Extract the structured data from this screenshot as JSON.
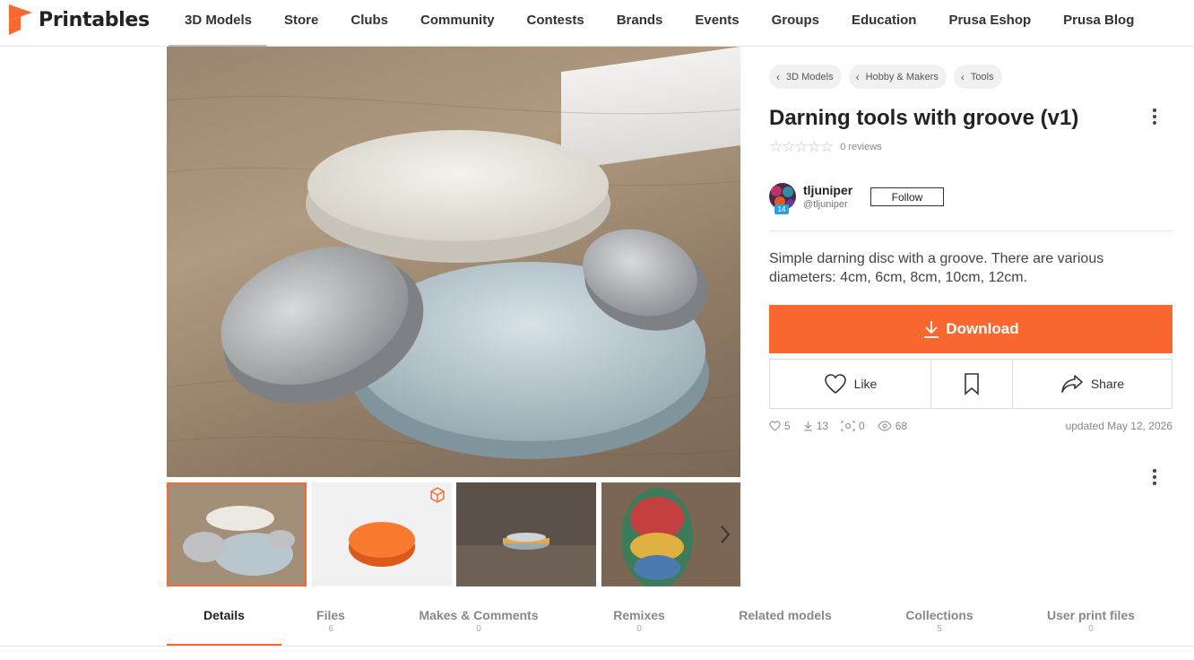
{
  "brand": {
    "name": "Printables",
    "accent": "#fa6831"
  },
  "nav": {
    "items": [
      "3D Models",
      "Store",
      "Clubs",
      "Community",
      "Contests",
      "Brands",
      "Events",
      "Groups",
      "Education",
      "Prusa Eshop",
      "Prusa Blog"
    ]
  },
  "gallery": {
    "main_photo_alt": "darning-discs-photo",
    "next_icon": "chevron-right-icon",
    "thumbnail_model_badge_icon": "3d-cube-icon"
  },
  "breadcrumbs": [
    "3D Models",
    "Hobby & Makers",
    "Tools"
  ],
  "model": {
    "title": "Darning tools with groove (v1)",
    "reviews": "0 reviews",
    "description": "Simple darning disc with a groove. There are various diameters: 4cm, 6cm, 8cm, 10cm, 12cm."
  },
  "author": {
    "name": "tljuniper",
    "handle": "@tljuniper",
    "level": "14",
    "follow_label": "Follow"
  },
  "actions": {
    "download": "Download",
    "like": "Like",
    "share": "Share",
    "bookmark_icon": "bookmark-icon"
  },
  "stats": {
    "likes": "5",
    "downloads": "13",
    "makes": "0",
    "views": "68",
    "updated": "updated May 12, 2026"
  },
  "tabs": [
    {
      "label": "Details",
      "count": ""
    },
    {
      "label": "Files",
      "count": "6"
    },
    {
      "label": "Makes & Comments",
      "count": "0"
    },
    {
      "label": "Remixes",
      "count": "0"
    },
    {
      "label": "Related models",
      "count": ""
    },
    {
      "label": "Collections",
      "count": "5"
    },
    {
      "label": "User print files",
      "count": "0"
    }
  ]
}
